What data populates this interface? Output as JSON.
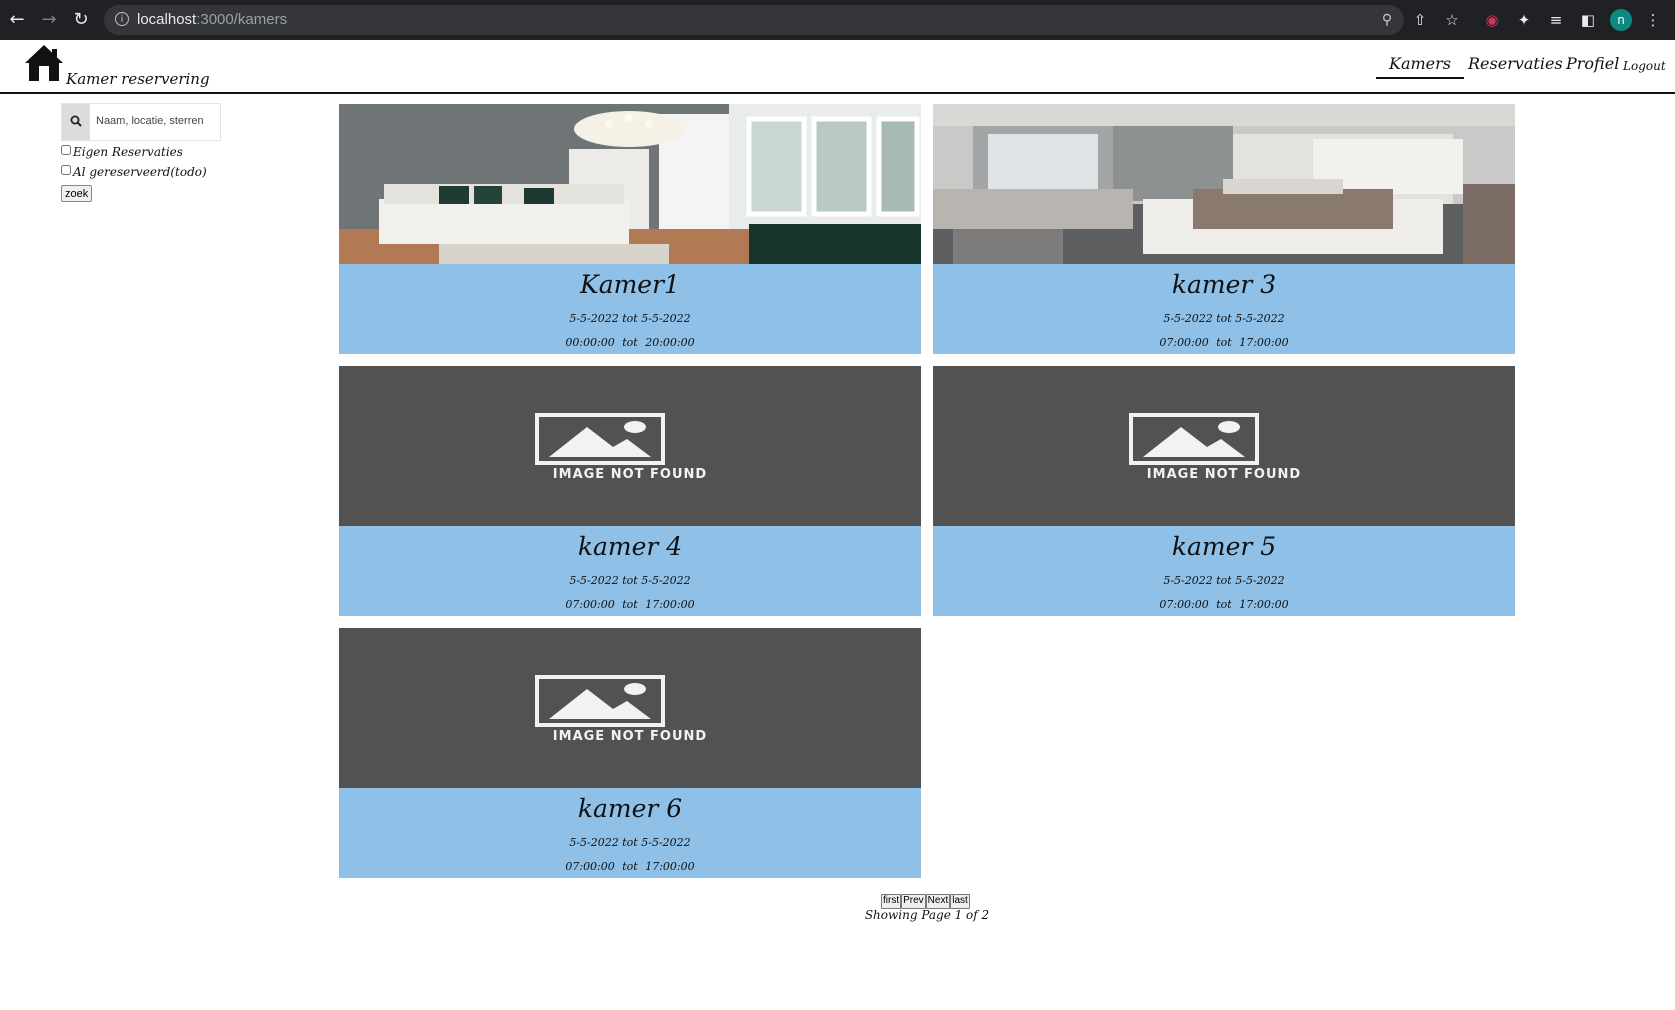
{
  "browser": {
    "url_host": "localhost",
    "url_path": ":3000/kamers",
    "profile_initial": "n"
  },
  "app": {
    "brand": "Kamer reservering",
    "nav": {
      "kamers": "Kamers",
      "reservaties": "Reservaties",
      "profiel": "Profiel",
      "logout": "Logout"
    }
  },
  "sidebar": {
    "search_placeholder": "Naam, locatie, sterren",
    "search_value": "",
    "filters": [
      {
        "label": "Eigen Reservaties",
        "checked": false
      },
      {
        "label": "Al gereserveerd(todo)",
        "checked": false
      }
    ],
    "search_button": "zoek"
  },
  "rooms": [
    {
      "name": "Kamer1",
      "image": "photo",
      "dates": "5-5-2022 tot 5-5-2022",
      "times": "00:00:00 tot 20:00:00"
    },
    {
      "name": "kamer 3",
      "image": "photo",
      "dates": "5-5-2022 tot 5-5-2022",
      "times": "07:00:00 tot 17:00:00"
    },
    {
      "name": "kamer 4",
      "image": "not-found",
      "dates": "5-5-2022 tot 5-5-2022",
      "times": "07:00:00 tot 17:00:00"
    },
    {
      "name": "kamer 5",
      "image": "not-found",
      "dates": "5-5-2022 tot 5-5-2022",
      "times": "07:00:00 tot 17:00:00"
    },
    {
      "name": "kamer 6",
      "image": "not-found",
      "dates": "5-5-2022 tot 5-5-2022",
      "times": "07:00:00 tot 17:00:00"
    }
  ],
  "image_not_found_label": "IMAGE NOT FOUND",
  "pagination": {
    "first": "first",
    "prev": "Prev",
    "next": "Next",
    "last": "last",
    "info": "Showing Page 1 of 2"
  },
  "colors": {
    "card_info_bg": "#8ec0e8",
    "not_found_bg": "#525252",
    "chrome_bg": "#202124"
  }
}
